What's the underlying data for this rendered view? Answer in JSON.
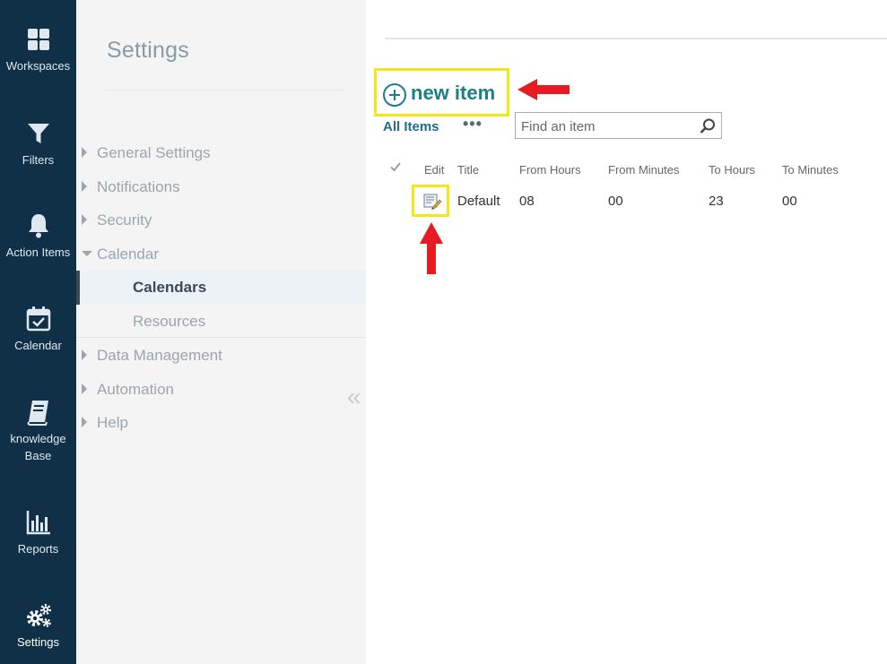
{
  "rail": {
    "items": [
      {
        "label": "Workspaces",
        "icon": "grid-icon"
      },
      {
        "label": "Filters",
        "icon": "filter-icon"
      },
      {
        "label": "Action Items",
        "icon": "bell-icon"
      },
      {
        "label": "Calendar",
        "icon": "calendar-check-icon"
      },
      {
        "label_line1": "knowledge",
        "label_line2": "Base",
        "icon": "book-icon"
      },
      {
        "label": "Reports",
        "icon": "bar-chart-icon"
      },
      {
        "label": "Settings",
        "icon": "gears-icon"
      }
    ]
  },
  "panel": {
    "title": "Settings",
    "nav": [
      {
        "label": "General Settings",
        "expanded": false
      },
      {
        "label": "Notifications",
        "expanded": false
      },
      {
        "label": "Security",
        "expanded": false
      },
      {
        "label": "Calendar",
        "expanded": true
      },
      {
        "label": "Data Management",
        "expanded": false
      },
      {
        "label": "Automation",
        "expanded": false
      },
      {
        "label": "Help",
        "expanded": false
      }
    ],
    "calendar_sub": [
      {
        "label": "Calendars",
        "active": true
      },
      {
        "label": "Resources",
        "active": false
      }
    ],
    "collapse_glyph": "«"
  },
  "list": {
    "new_item_label": "new item",
    "view_label": "All Items",
    "more_label": "•••",
    "search_placeholder": "Find an item",
    "columns": [
      "Edit",
      "Title",
      "From Hours",
      "From Minutes",
      "To Hours",
      "To Minutes"
    ],
    "rows": [
      {
        "title": "Default",
        "from_hours": "08",
        "from_minutes": "00",
        "to_hours": "23",
        "to_minutes": "00"
      }
    ]
  },
  "colors": {
    "rail_bg": "#0f3047",
    "accent_teal": "#1b7f86",
    "highlight_yellow": "#f5e619",
    "annotation_red": "#e81b23"
  }
}
